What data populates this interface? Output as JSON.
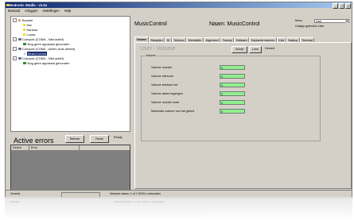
{
  "window": {
    "title": "Beutronic Studio - v1.0a",
    "controls": [
      "_",
      "□",
      "×"
    ]
  },
  "menubar": [
    "Bestand",
    "Inloggen",
    "Instellingen",
    "Help"
  ],
  "tree": [
    {
      "label": "Bouwel",
      "icon": "house-icon",
      "expander": "−"
    },
    {
      "label": "Hal",
      "icon": "bulb-icon"
    },
    {
      "label": "Kantoor",
      "icon": "bulb-icon"
    },
    {
      "label": "Loods",
      "icon": "bulb-icon"
    },
    {
      "label": "Comport (COM4 - Niet actief)",
      "icon": "port-icon",
      "expander": "−"
    },
    {
      "label": "Nog geen apparaat gevonden",
      "icon": "device-icon"
    },
    {
      "label": "Comport (COM4 - Actief, Auto detect)",
      "icon": "port-icon",
      "expander": "−"
    },
    {
      "label": "MusicControl",
      "icon": "music-icon",
      "selected": true
    },
    {
      "label": "Comport (COM4 - Niet actief)",
      "icon": "port-icon",
      "expander": "−"
    },
    {
      "label": "Nog geen apparaat gevonden",
      "icon": "device-icon"
    }
  ],
  "active_errors": {
    "title": "Active errors",
    "refresh_label": "Refresh",
    "reset_label": "Reset",
    "status": "Ready",
    "columns": [
      "Device",
      "Error"
    ]
  },
  "right": {
    "title": "MusicControl",
    "name_label": "Naam: MusicControl",
    "menu_label": "Menu",
    "current_user_label": "Huidige gebruiker",
    "current_user_value": "User",
    "user_select_value": "User"
  },
  "tabs": [
    "Volume",
    "Stautpfen",
    "ID",
    "Telefoon",
    "Melodieën",
    "Algemeen",
    "Factory",
    "Software",
    "Geplande alarmen",
    "Klok",
    "Backup",
    "Terminal"
  ],
  "panel": {
    "title": "User - Volume",
    "schrijf_label": "Schrijf",
    "lees_label": "Lees",
    "status": "Gereed",
    "group_title": "Volume",
    "rows": [
      {
        "label": "Volume muziek",
        "value": "0"
      },
      {
        "label": "Volume intercom",
        "value": "0"
      },
      {
        "label": "Volume telefoon bel",
        "value": "0"
      },
      {
        "label": "Volume alarm ingangen",
        "value": "0"
      },
      {
        "label": "Volume muziek mute",
        "value": "0"
      },
      {
        "label": "Maximale volume van het geluid",
        "value": "0"
      }
    ]
  },
  "statusbar": {
    "left": "Gereed",
    "network": "Network status: 2 of 2 SNG's verbonden"
  },
  "colors": {
    "titlebar_start": "#0a246a",
    "titlebar_end": "#a6caf0",
    "input_fill": "#8ff08f",
    "selection": "#0a246a"
  }
}
